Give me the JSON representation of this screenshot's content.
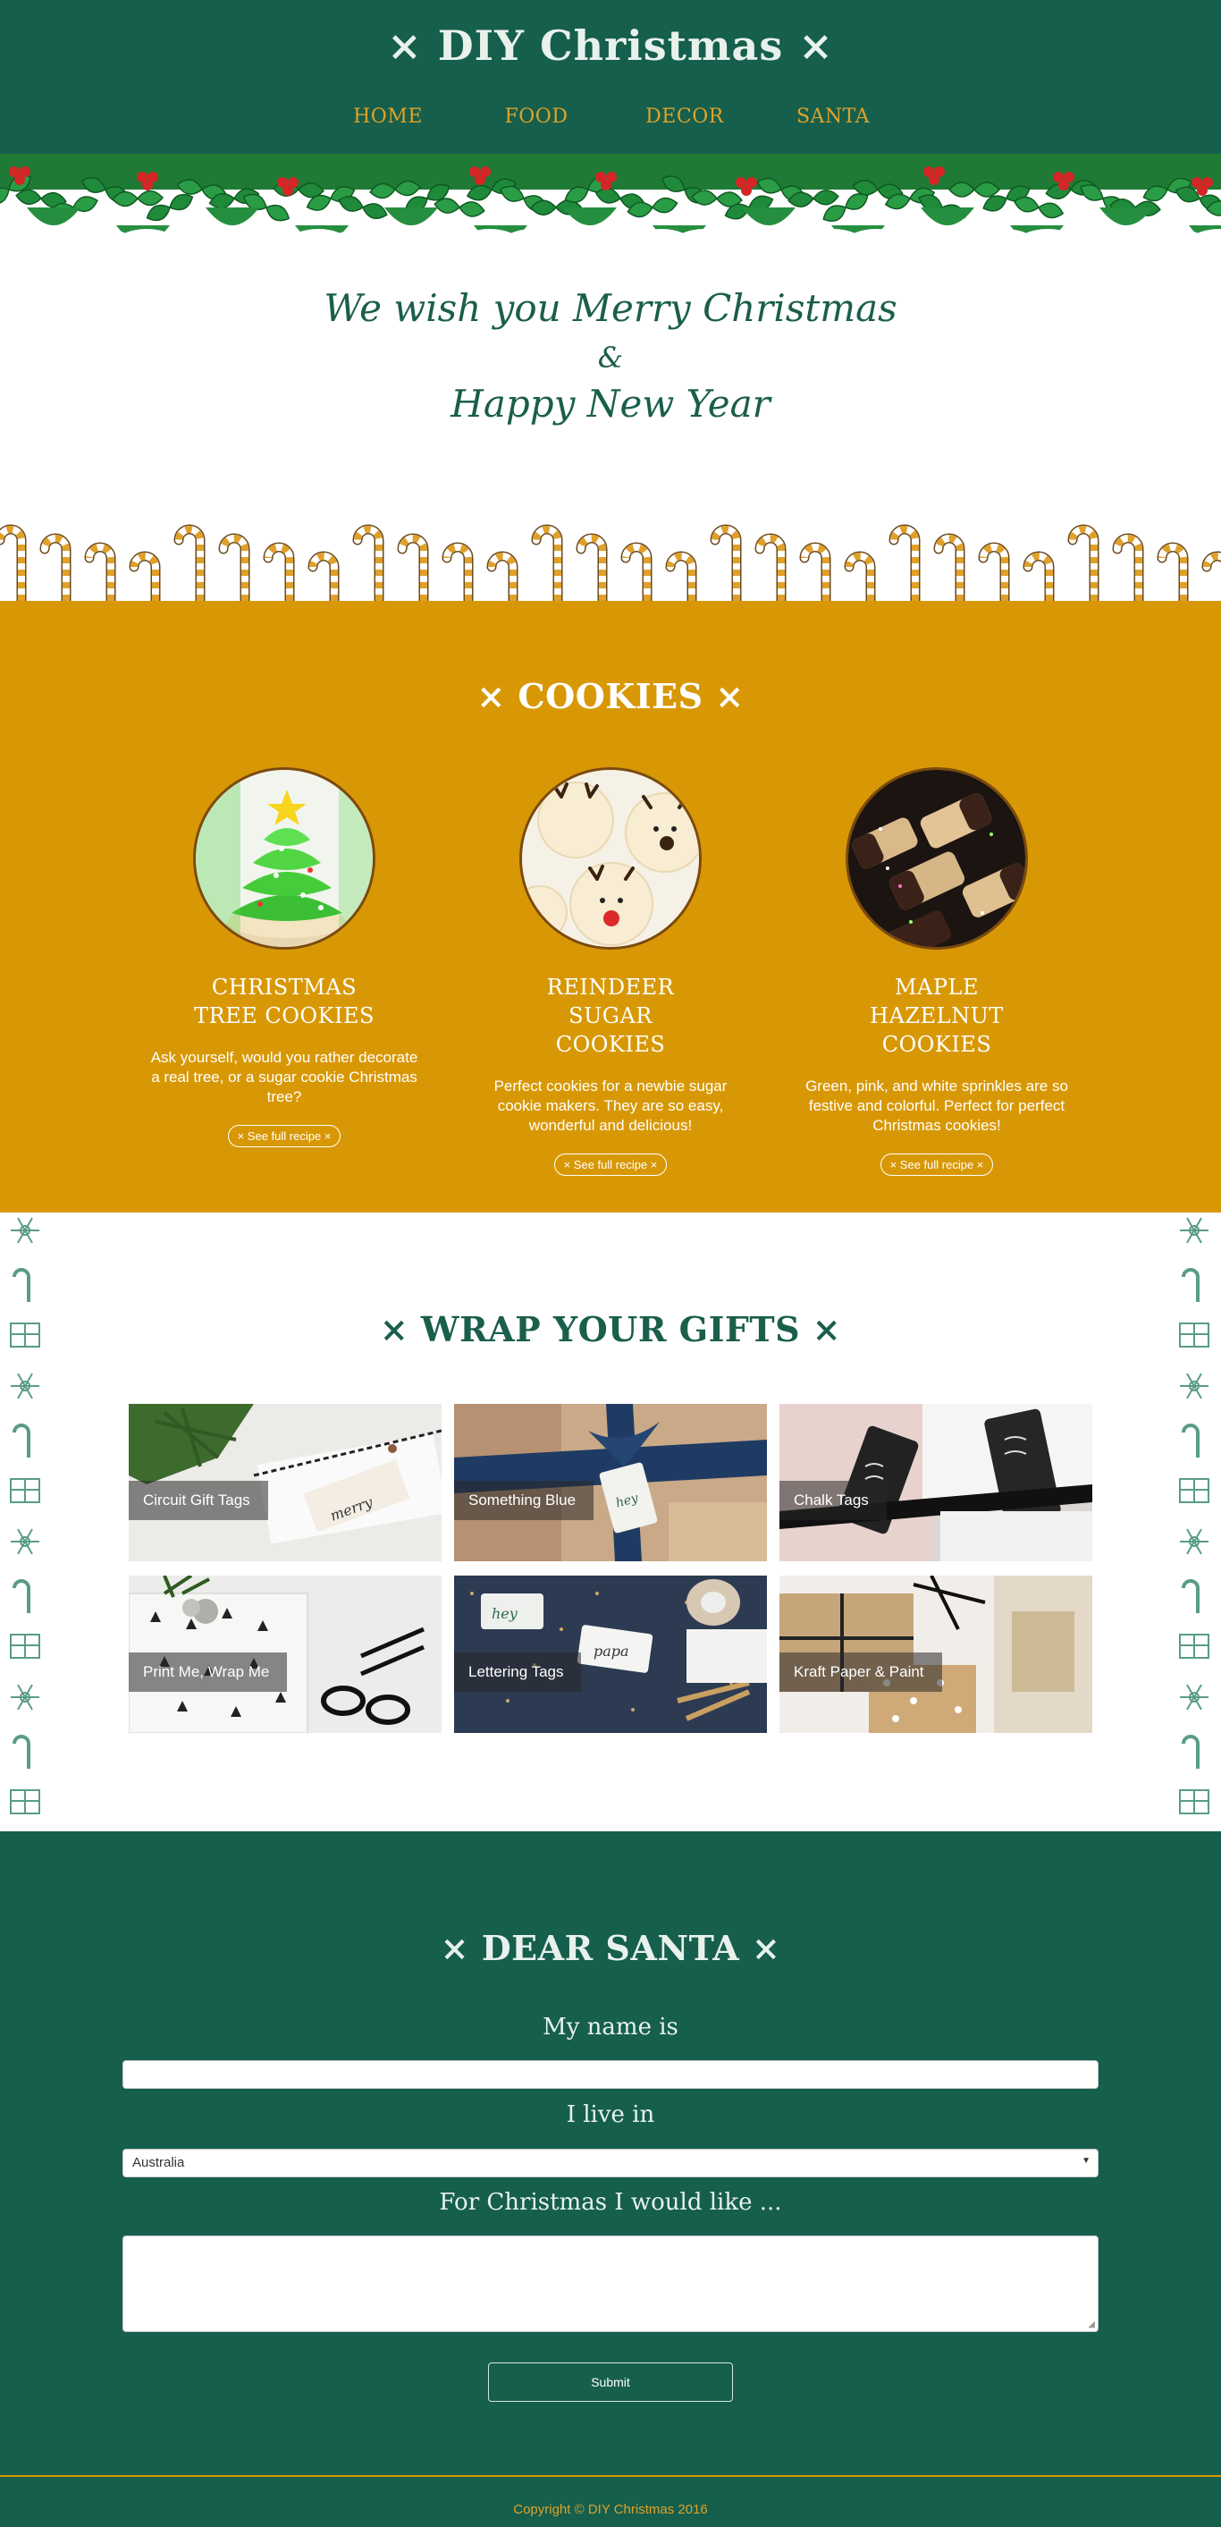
{
  "header": {
    "title": "× DIY Christmas ×",
    "nav": [
      "HOME",
      "FOOD",
      "DECOR",
      "SANTA"
    ]
  },
  "welcome": {
    "line1": "We wish you Merry Christmas",
    "amp": "&",
    "line2": "Happy New Year"
  },
  "cookies": {
    "title": "× COOKIES ×",
    "items": [
      {
        "name": "CHRISTMAS TREE COOKIES",
        "desc": "Ask yourself, would you rather decorate a real tree, or a sugar cookie Christmas tree?",
        "button": "× See full recipe ×"
      },
      {
        "name": "REINDEER SUGAR COOKIES",
        "desc": "Perfect cookies for a newbie sugar cookie makers. They are so easy, wonderful and delicious!",
        "button": "× See full recipe ×"
      },
      {
        "name": "MAPLE HAZELNUT COOKIES",
        "desc": "Green, pink, and white sprinkles are so festive and colorful. Perfect for perfect Christmas cookies!",
        "button": "× See full recipe ×"
      }
    ]
  },
  "wrap": {
    "title": "× WRAP YOUR GIFTS ×",
    "tiles": [
      "Circuit Gift Tags",
      "Something Blue",
      "Chalk Tags",
      "Print Me, Wrap Me",
      "Lettering Tags",
      "Kraft Paper & Paint"
    ]
  },
  "santa": {
    "title": "× DEAR SANTA ×",
    "name_label": "My name is",
    "name_value": "",
    "country_label": "I live in",
    "country_value": "Australia",
    "wish_label": "For Christmas I would like ...",
    "wish_value": "",
    "submit": "Submit"
  },
  "footer": {
    "text": "Copyright © DIY Christmas 2016"
  },
  "colors": {
    "green": "#155f4c",
    "gold": "#d89805",
    "nav_gold": "#e0a12a",
    "white": "#ffffff"
  }
}
